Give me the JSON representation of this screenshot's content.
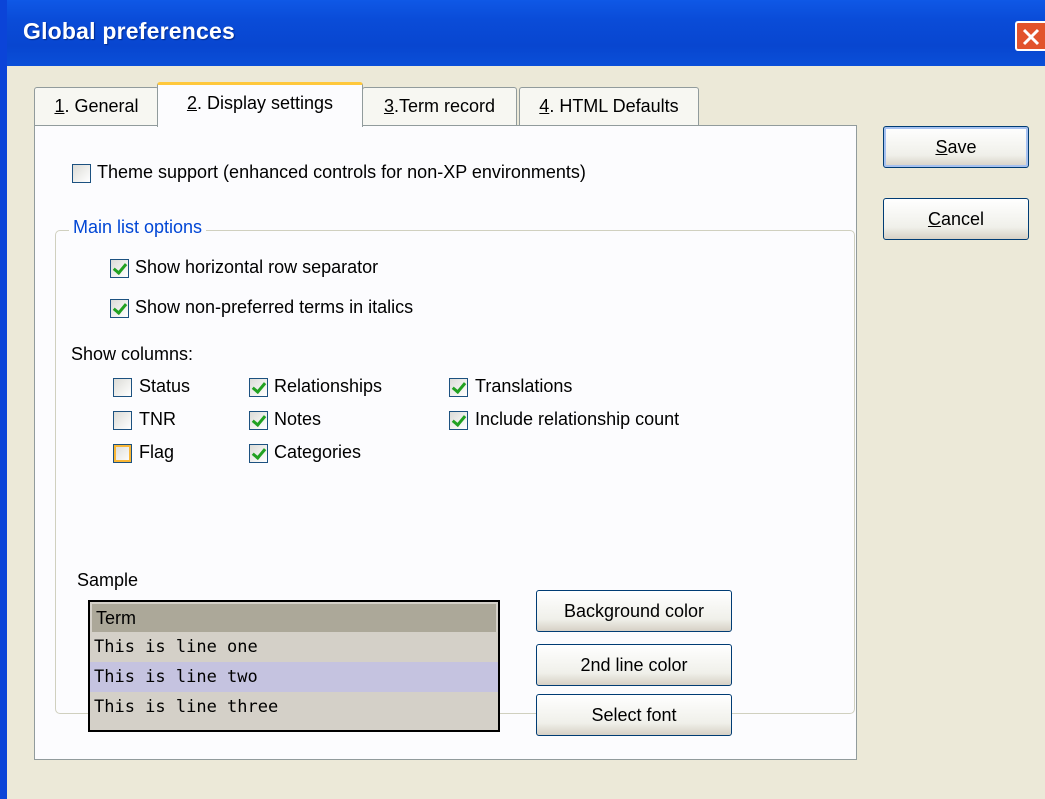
{
  "window": {
    "title": "Global preferences"
  },
  "tabs": [
    {
      "key": "1",
      "label": ". General"
    },
    {
      "key": "2",
      "label": ". Display settings"
    },
    {
      "key": "3",
      "label": ".Term record"
    },
    {
      "key": "4",
      "label": ". HTML Defaults"
    }
  ],
  "theme_support": {
    "label": "Theme support (enhanced controls for non-XP environments)",
    "checked": false
  },
  "main_list": {
    "title": "Main list options",
    "row_separator": {
      "label": "Show horizontal row separator",
      "checked": true
    },
    "italics": {
      "label": "Show non-preferred terms in italics",
      "checked": true
    },
    "columns_label": "Show columns:",
    "columns": {
      "status": {
        "label": "Status",
        "checked": false
      },
      "tnr": {
        "label": "TNR",
        "checked": false
      },
      "flag": {
        "label": "Flag",
        "checked": false
      },
      "relationships": {
        "label": "Relationships",
        "checked": true
      },
      "notes": {
        "label": "Notes",
        "checked": true
      },
      "categories": {
        "label": "Categories",
        "checked": true
      },
      "translations": {
        "label": "Translations",
        "checked": true
      },
      "relationship_count": {
        "label": "Include relationship count",
        "checked": true
      }
    }
  },
  "sample": {
    "label": "Sample",
    "rows": [
      "Term",
      "This is line one",
      "This is line two",
      "This is line three"
    ]
  },
  "sample_buttons": {
    "background_color": "Background color",
    "second_line_color": "2nd line color",
    "select_font": "Select font"
  },
  "actions": {
    "save": {
      "accel": "S",
      "rest": "ave"
    },
    "cancel": {
      "accel": "C",
      "rest": "ancel"
    }
  },
  "colors": {
    "titlebar": "#0a4cd8",
    "close_button": "#e2532c",
    "group_title": "#0046d5",
    "check_mark": "#21a121",
    "sample_header": "#aca899",
    "sample_alt_row": "#c5c3e0"
  }
}
